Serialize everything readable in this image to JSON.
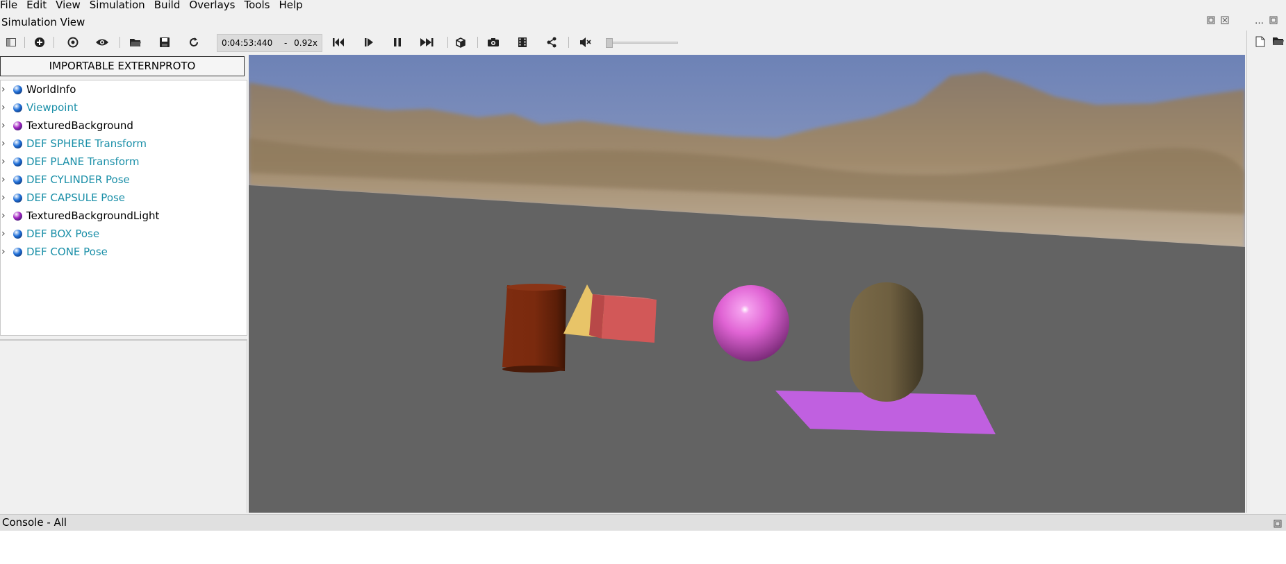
{
  "menu": [
    "File",
    "Edit",
    "View",
    "Simulation",
    "Build",
    "Overlays",
    "Tools",
    "Help"
  ],
  "simulation_view": {
    "title": "Simulation View",
    "time": "0:04:53:440",
    "separator": "-",
    "speed": "0.92x",
    "volume_level": 0
  },
  "toolbar": {
    "buttons": [
      "toggle-scene-tree-icon",
      "add-node-icon",
      "sync-viewpoint-icon",
      "eye-icon",
      "open-world-icon",
      "save-world-icon",
      "reload-world-icon",
      "reset-icon",
      "step-icon",
      "pause-icon",
      "fast-forward-icon",
      "view-cube-icon",
      "screenshot-icon",
      "movie-icon",
      "share-icon",
      "mute-icon"
    ]
  },
  "scene_tree": {
    "proto_button": "IMPORTABLE EXTERNPROTO",
    "nodes": [
      {
        "label": "WorldInfo",
        "color": "#000000",
        "ball": "#1e6fd9"
      },
      {
        "label": "Viewpoint",
        "color": "#1a8fa8",
        "ball": "#1e6fd9"
      },
      {
        "label": "TexturedBackground",
        "color": "#000000",
        "ball": "#a020c0"
      },
      {
        "label": "DEF SPHERE Transform",
        "color": "#1a8fa8",
        "ball": "#1e6fd9"
      },
      {
        "label": "DEF PLANE Transform",
        "color": "#1a8fa8",
        "ball": "#1e6fd9"
      },
      {
        "label": "DEF CYLINDER Pose",
        "color": "#1a8fa8",
        "ball": "#1e6fd9"
      },
      {
        "label": "DEF CAPSULE Pose",
        "color": "#1a8fa8",
        "ball": "#1e6fd9"
      },
      {
        "label": "TexturedBackgroundLight",
        "color": "#000000",
        "ball": "#a020c0"
      },
      {
        "label": "DEF BOX Pose",
        "color": "#1a8fa8",
        "ball": "#1e6fd9"
      },
      {
        "label": "DEF CONE Pose",
        "color": "#1a8fa8",
        "ball": "#1e6fd9"
      }
    ]
  },
  "scene_3d": {
    "objects": [
      {
        "name": "cylinder",
        "color": "#7a2a10"
      },
      {
        "name": "cone",
        "color": "#e8c468"
      },
      {
        "name": "box",
        "color": "#d25858"
      },
      {
        "name": "sphere",
        "color": "#e060d0"
      },
      {
        "name": "capsule",
        "color": "#6e5f40"
      },
      {
        "name": "plane",
        "color": "#c060e0"
      }
    ],
    "floor_color": "#636363"
  },
  "console": {
    "title": "Console - All"
  }
}
